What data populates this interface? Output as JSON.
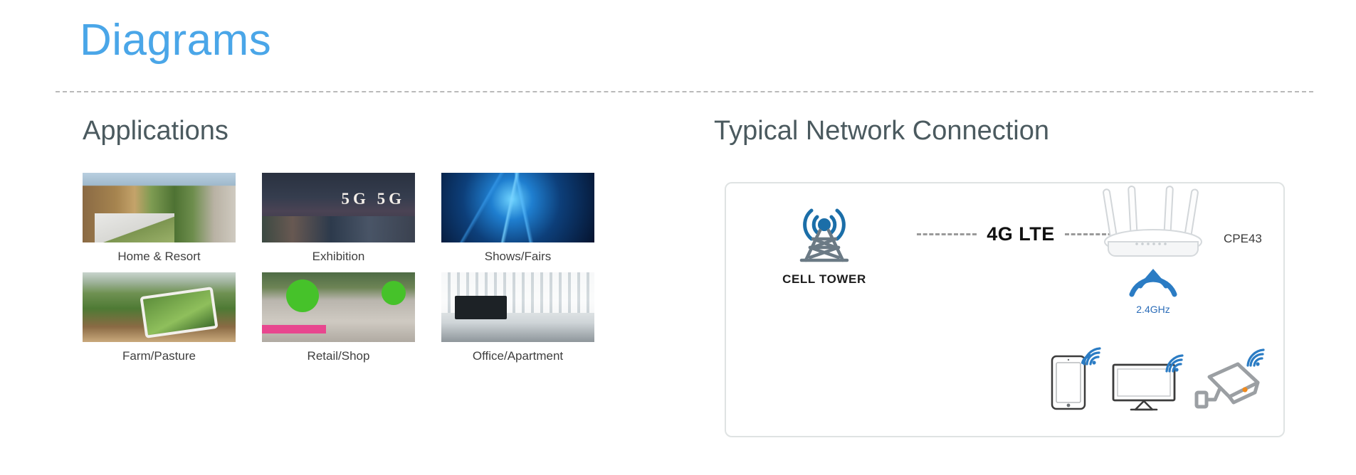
{
  "page": {
    "title": "Diagrams"
  },
  "applications": {
    "heading": "Applications",
    "items": [
      {
        "caption": "Home & Resort",
        "art": "home-resort-photo"
      },
      {
        "caption": "Exhibition",
        "art": "exhibition-photo"
      },
      {
        "caption": "Shows/Fairs",
        "art": "shows-fairs-photo"
      },
      {
        "caption": "Farm/Pasture",
        "art": "farm-pasture-photo"
      },
      {
        "caption": "Retail/Shop",
        "art": "retail-shop-photo"
      },
      {
        "caption": "Office/Apartment",
        "art": "office-apartment-photo"
      }
    ]
  },
  "network": {
    "heading": "Typical Network Connection",
    "tower_label": "CELL TOWER",
    "link_label": "4G LTE",
    "router_label": "CPE43",
    "band_label": "2.4GHz",
    "clients": [
      {
        "name": "tablet"
      },
      {
        "name": "tv-monitor"
      },
      {
        "name": "security-camera"
      }
    ]
  },
  "colors": {
    "title_blue": "#4aa6e8",
    "heading_gray": "#4b5a5f",
    "tower_gray": "#6b7a85",
    "signal_blue": "#1b6ea8",
    "wifi_blue": "#2b7cc4",
    "panel_border": "#dfe3e3",
    "camera_dot": "#f08a1c"
  }
}
